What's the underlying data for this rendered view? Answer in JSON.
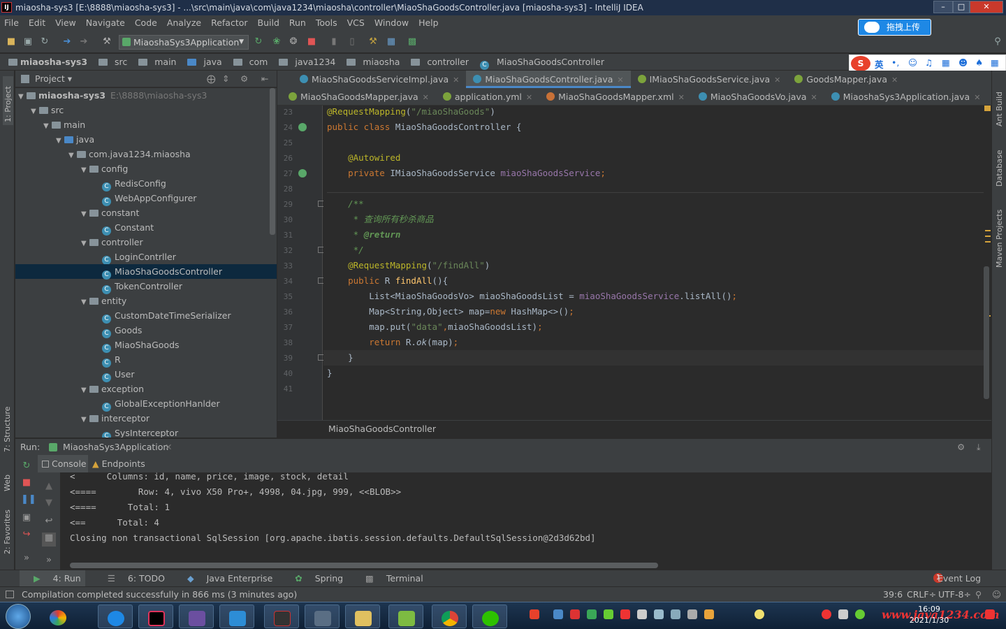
{
  "window": {
    "title": "miaosha-sys3 [E:\\8888\\miaosha-sys3] - ...\\src\\main\\java\\com\\java1234\\miaosha\\controller\\MiaoShaGoodsController.java [miaosha-sys3] - IntelliJ IDEA",
    "app_icon": "IJ",
    "minimize": "–",
    "maximize": "□",
    "close": "✕"
  },
  "menu": [
    "File",
    "Edit",
    "View",
    "Navigate",
    "Code",
    "Analyze",
    "Refactor",
    "Build",
    "Run",
    "Tools",
    "VCS",
    "Window",
    "Help"
  ],
  "toolbar": {
    "run_config": "MiaoshaSys3Application",
    "upload_label": "拖拽上传"
  },
  "breadcrumb": [
    "miaosha-sys3",
    "src",
    "main",
    "java",
    "com",
    "java1234",
    "miaosha",
    "controller",
    "MiaoShaGoodsController"
  ],
  "ime": {
    "mode": "英"
  },
  "left_strip": {
    "project": "1: Project",
    "structure": "7: Structure",
    "web": "Web",
    "favorites": "2: Favorites"
  },
  "right_strip": {
    "ant": "Ant Build",
    "database": "Database",
    "maven": "Maven Projects"
  },
  "project_panel": {
    "title": "Project",
    "tree": [
      {
        "label": "miaosha-sys3",
        "extra": "E:\\8888\\miaosha-sys3",
        "depth": 0,
        "kind": "module",
        "open": true
      },
      {
        "label": "src",
        "depth": 1,
        "kind": "folder",
        "open": true
      },
      {
        "label": "main",
        "depth": 2,
        "kind": "folder",
        "open": true
      },
      {
        "label": "java",
        "depth": 3,
        "kind": "folder",
        "open": true
      },
      {
        "label": "com.java1234.miaosha",
        "depth": 4,
        "kind": "package",
        "open": true
      },
      {
        "label": "config",
        "depth": 5,
        "kind": "package",
        "open": true
      },
      {
        "label": "RedisConfig",
        "depth": 6,
        "kind": "class"
      },
      {
        "label": "WebAppConfigurer",
        "depth": 6,
        "kind": "class"
      },
      {
        "label": "constant",
        "depth": 5,
        "kind": "package",
        "open": true
      },
      {
        "label": "Constant",
        "depth": 6,
        "kind": "class"
      },
      {
        "label": "controller",
        "depth": 5,
        "kind": "package",
        "open": true
      },
      {
        "label": "LoginContrller",
        "depth": 6,
        "kind": "class"
      },
      {
        "label": "MiaoShaGoodsController",
        "depth": 6,
        "kind": "class",
        "selected": true
      },
      {
        "label": "TokenController",
        "depth": 6,
        "kind": "class"
      },
      {
        "label": "entity",
        "depth": 5,
        "kind": "package",
        "open": true
      },
      {
        "label": "CustomDateTimeSerializer",
        "depth": 6,
        "kind": "class"
      },
      {
        "label": "Goods",
        "depth": 6,
        "kind": "class"
      },
      {
        "label": "MiaoShaGoods",
        "depth": 6,
        "kind": "class"
      },
      {
        "label": "R",
        "depth": 6,
        "kind": "class"
      },
      {
        "label": "User",
        "depth": 6,
        "kind": "class"
      },
      {
        "label": "exception",
        "depth": 5,
        "kind": "package",
        "open": true
      },
      {
        "label": "GlobalExceptionHanlder",
        "depth": 6,
        "kind": "class"
      },
      {
        "label": "interceptor",
        "depth": 5,
        "kind": "package",
        "open": true
      },
      {
        "label": "SysInterceptor",
        "depth": 6,
        "kind": "class"
      }
    ]
  },
  "editor_tabs_row1": [
    {
      "label": "MiaoShaGoodsServiceImpl.java",
      "icon": "#3d8fb2",
      "active": false
    },
    {
      "label": "MiaoShaGoodsController.java",
      "icon": "#3d8fb2",
      "active": true
    },
    {
      "label": "IMiaoShaGoodsService.java",
      "icon": "#7ca33c",
      "active": false
    },
    {
      "label": "GoodsMapper.java",
      "icon": "#7ca33c",
      "active": false
    }
  ],
  "editor_tabs_row2": [
    {
      "label": "MiaoShaGoodsMapper.java",
      "icon": "#7ca33c"
    },
    {
      "label": "application.yml",
      "icon": "#7ca33c"
    },
    {
      "label": "MiaoShaGoodsMapper.xml",
      "icon": "#c87137"
    },
    {
      "label": "MiaoShaGoodsVo.java",
      "icon": "#3d8fb2"
    },
    {
      "label": "MiaoshaSys3Application.java",
      "icon": "#3d8fb2"
    }
  ],
  "code_lines": [
    {
      "n": "23",
      "html": "<span class='ann'>@RequestMapping</span><span class='plain'>(</span><span class='str'>\"/miaoShaGoods\"</span><span class='plain'>)</span>"
    },
    {
      "n": "24",
      "html": "<span class='kw'>public class </span><span class='plain'>MiaoShaGoodsController {</span>"
    },
    {
      "n": "25",
      "html": ""
    },
    {
      "n": "26",
      "html": "    <span class='ann'>@Autowired</span>"
    },
    {
      "n": "27",
      "html": "    <span class='kw'>private </span><span class='plain'>IMiaoShaGoodsService </span><span class='fld'>miaoShaGoodsService</span><span class='kw'>;</span>"
    },
    {
      "n": "28",
      "html": ""
    },
    {
      "n": "29",
      "html": "    <span class='cmt'>/**</span>"
    },
    {
      "n": "30",
      "html": "    <span class='cmt'> * 查询所有秒杀商品</span>"
    },
    {
      "n": "31",
      "html": "    <span class='cmt'> * <b>@return</b></span>"
    },
    {
      "n": "32",
      "html": "    <span class='cmt'> */</span>"
    },
    {
      "n": "33",
      "html": "    <span class='ann'>@RequestMapping</span><span class='plain'>(</span><span class='str'>\"/findAll\"</span><span class='plain'>)</span>"
    },
    {
      "n": "34",
      "html": "    <span class='kw'>public </span><span class='plain'>R </span><span class='mth'>findAll</span><span class='plain'>(){</span>"
    },
    {
      "n": "35",
      "html": "        <span class='plain'>List&lt;MiaoShaGoodsVo&gt; miaoShaGoodsList = </span><span class='fld'>miaoShaGoodsService</span><span class='plain'>.listAll()</span><span class='kw'>;</span>"
    },
    {
      "n": "36",
      "html": "        <span class='plain'>Map&lt;String,Object&gt; map=</span><span class='kw'>new </span><span class='plain'>HashMap&lt;&gt;()</span><span class='kw'>;</span>"
    },
    {
      "n": "37",
      "html": "        <span class='plain'>map.put(</span><span class='str'>\"data\"</span><span class='kw'>,</span><span class='plain'>miaoShaGoodsList)</span><span class='kw'>;</span>"
    },
    {
      "n": "38",
      "html": "        <span class='kw'>return </span><span class='plain'>R.<i>ok</i>(map)</span><span class='kw'>;</span>"
    },
    {
      "n": "39",
      "html": "    <span class='plain'>}</span>"
    },
    {
      "n": "40",
      "html": "<span class='plain'>}</span>"
    },
    {
      "n": "41",
      "html": ""
    }
  ],
  "editor_footer": "MiaoShaGoodsController",
  "run_panel": {
    "label": "Run:",
    "config": "MiaoshaSys3Application",
    "tabs": [
      "Console",
      "Endpoints"
    ]
  },
  "console_lines": [
    "<      Columns: id, name, price, image, stock, detail",
    "<====        Row: 4, vivo X50 Pro+, 4998, 04.jpg, 999, <<BLOB>>",
    "<====      Total: 1",
    "<==      Total: 4",
    "Closing non transactional SqlSession [org.apache.ibatis.session.defaults.DefaultSqlSession@2d3d62bd]"
  ],
  "bottom_tools": [
    "4: Run",
    "6: TODO",
    "Java Enterprise",
    "Spring",
    "Terminal"
  ],
  "event_log": "Event Log",
  "event_count": "1",
  "status": {
    "message": "Compilation completed successfully in 866 ms (3 minutes ago)",
    "position": "39:6",
    "line_sep": "CRLF÷",
    "encoding": "UTF-8÷"
  },
  "taskbar": {
    "time": "16:09",
    "date": "2021/1/30",
    "watermark": "www.java1234.com"
  }
}
